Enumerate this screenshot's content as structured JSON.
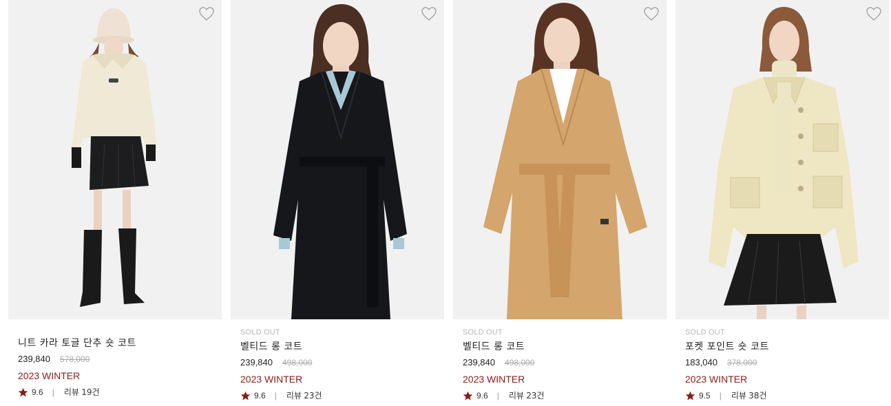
{
  "products": [
    {
      "sold_out": "",
      "name": "니트 카라 토글 단추 숏 코트",
      "price": "239,840",
      "original_price": "578,000",
      "season": "2023 WINTER",
      "rating": "9.6",
      "review_label": "리뷰",
      "review_count": "19건",
      "coat_color": "#efe9d6",
      "icon": "heart-outline-icon"
    },
    {
      "sold_out": "SOLD OUT",
      "name": "벨티드 롱 코트",
      "price": "239,840",
      "original_price": "498,000",
      "season": "2023 WINTER",
      "rating": "9.6",
      "review_label": "리뷰",
      "review_count": "23건",
      "coat_color": "#15171b",
      "icon": "heart-outline-icon"
    },
    {
      "sold_out": "SOLD OUT",
      "name": "벨티드 롱 코트",
      "price": "239,840",
      "original_price": "498,000",
      "season": "2023 WINTER",
      "rating": "9.6",
      "review_label": "리뷰",
      "review_count": "23건",
      "coat_color": "#d4a56c",
      "icon": "heart-outline-icon"
    },
    {
      "sold_out": "SOLD OUT",
      "name": "포켓 포인트 숏 코트",
      "price": "183,040",
      "original_price": "378,000",
      "season": "2023 WINTER",
      "rating": "9.5",
      "review_label": "리뷰",
      "review_count": "38건",
      "coat_color": "#efe6c3",
      "icon": "heart-outline-icon"
    }
  ],
  "colors": {
    "season": "#8b1a1a",
    "star": "#8b1a1a",
    "image_bg": "#f1f1f1",
    "sold_out": "#b5b5b5"
  }
}
